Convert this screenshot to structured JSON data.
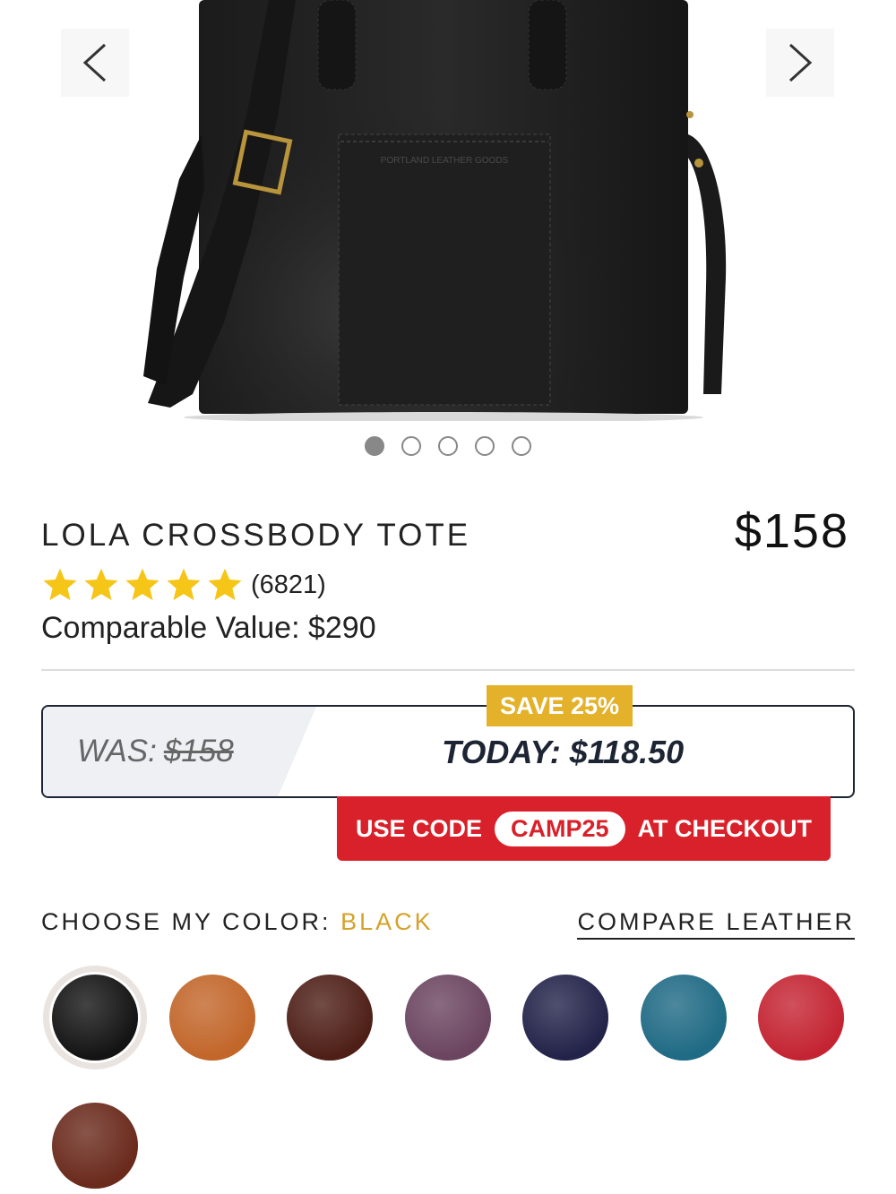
{
  "carousel": {
    "prev_icon": "chevron-left-icon",
    "next_icon": "chevron-right-icon",
    "slide_count": 5,
    "active_slide": 1,
    "image_stamp": "PORTLAND LEATHER GOODS"
  },
  "product": {
    "title": "LOLA CROSSBODY TOTE",
    "price": "$158",
    "rating": 5,
    "review_count": "(6821)",
    "comparable_value": "Comparable Value: $290"
  },
  "deal": {
    "save_badge": "SAVE 25%",
    "was_label": "WAS:",
    "was_amount": "$158",
    "today": "TODAY: $118.50",
    "code_prefix": "USE CODE",
    "code": "CAMP25",
    "code_suffix": "AT CHECKOUT"
  },
  "colors": {
    "label": "CHOOSE MY COLOR:",
    "selected": "BLACK",
    "compare_link": "COMPARE LEATHER",
    "swatches": [
      {
        "name": "black",
        "hex": "#141414"
      },
      {
        "name": "honey",
        "hex": "#c2662a"
      },
      {
        "name": "cognac",
        "hex": "#4e1f17"
      },
      {
        "name": "plum",
        "hex": "#6b4560"
      },
      {
        "name": "navy",
        "hex": "#23234a"
      },
      {
        "name": "teal",
        "hex": "#1f6a84"
      },
      {
        "name": "red",
        "hex": "#c42432"
      },
      {
        "name": "mahogany",
        "hex": "#6a2a1c"
      }
    ]
  },
  "theme": {
    "accent_gold": "#e3b12a",
    "promo_red": "#d8212a",
    "star_yellow": "#f5c518"
  }
}
